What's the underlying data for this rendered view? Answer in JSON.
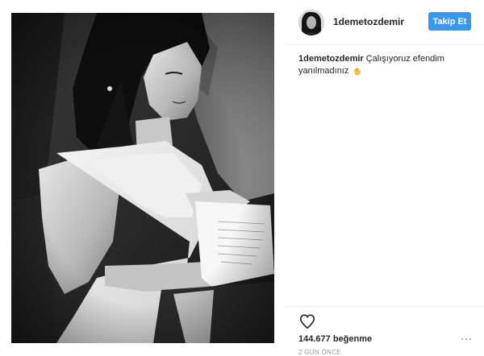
{
  "post": {
    "username": "1demetozdemir",
    "follow_label": "Takip Et",
    "caption_user": "1demetozdemir",
    "caption_text": "Çalışıyoruz efendim yanılmadınız",
    "caption_emoji": "waving-hand-emoji",
    "likes": "144.677 beğenme",
    "time": "2 GÜN ÖNCE"
  },
  "icons": {
    "like": "heart-outline-icon",
    "more": "ellipsis-icon"
  },
  "colors": {
    "follow_button": "#3897f0",
    "username": "#262626",
    "timestamp": "#999999",
    "divider": "#efefef"
  }
}
